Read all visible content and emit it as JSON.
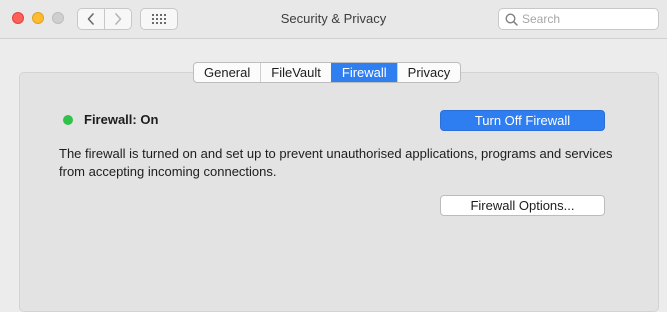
{
  "window": {
    "title": "Security & Privacy"
  },
  "search": {
    "placeholder": "Search"
  },
  "tabs": [
    {
      "label": "General",
      "active": false
    },
    {
      "label": "FileVault",
      "active": false
    },
    {
      "label": "Firewall",
      "active": true
    },
    {
      "label": "Privacy",
      "active": false
    }
  ],
  "firewall": {
    "status_label": "Firewall: On",
    "status_color": "#30c24b",
    "toggle_button_label": "Turn Off Firewall",
    "description": "The firewall is turned on and set up to prevent unauthorised applications, programs and services from accepting incoming connections.",
    "options_button_label": "Firewall Options..."
  },
  "icons": {
    "close": "close-window-icon",
    "minimize": "minimize-window-icon",
    "zoom": "zoom-window-icon",
    "back": "chevron-left-icon",
    "forward": "chevron-right-icon",
    "show_all": "grid-icon",
    "search": "search-icon",
    "status": "status-dot-icon"
  },
  "colors": {
    "accent": "#2f7ff0",
    "status_on": "#30c24b"
  }
}
